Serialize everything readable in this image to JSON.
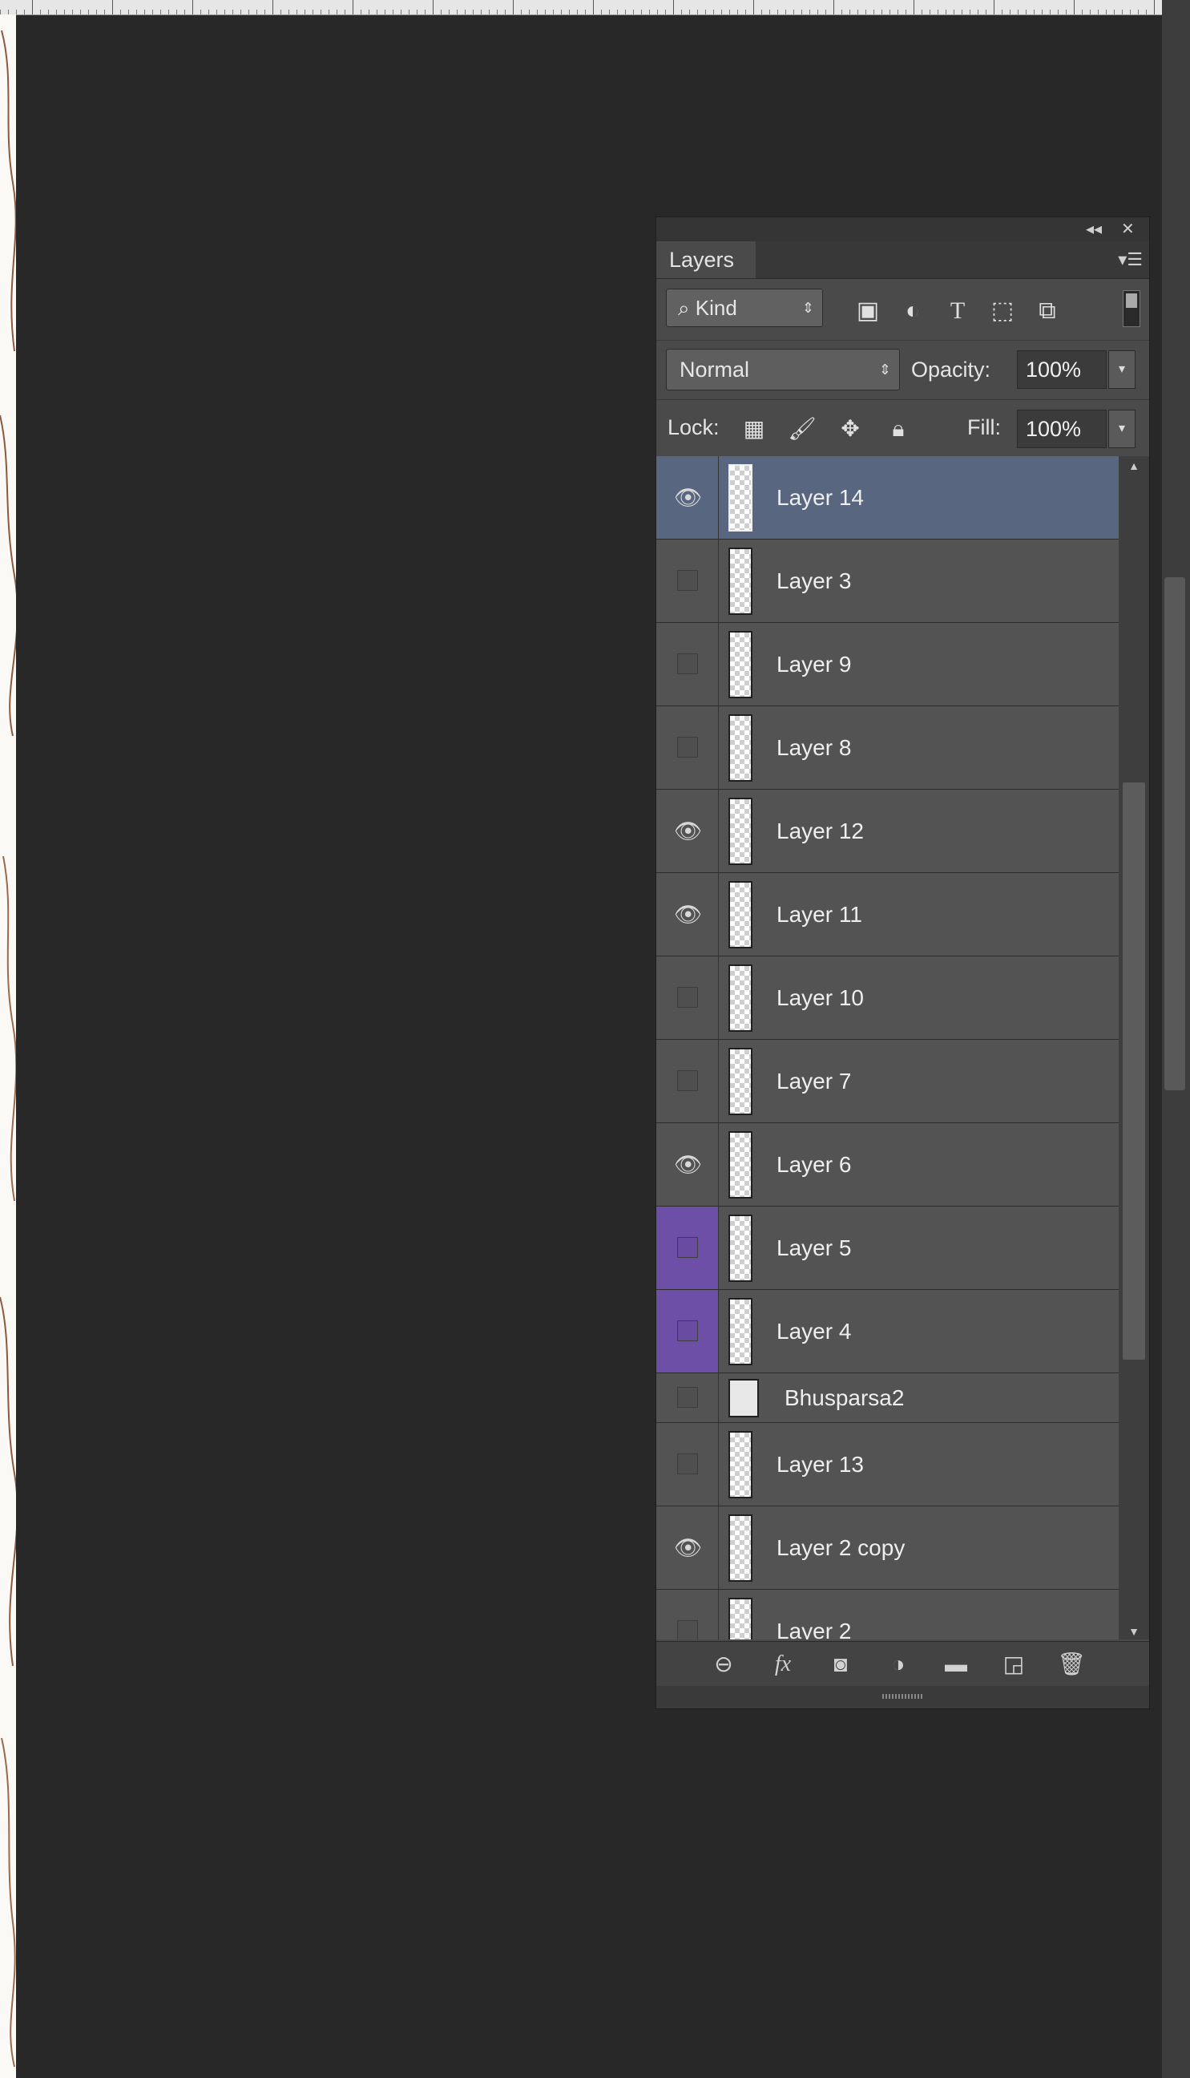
{
  "ruler": {},
  "panel": {
    "tab_label": "Layers",
    "collapse_label": "◂◂",
    "close_label": "✕",
    "menu_label": "▾☰",
    "filter": {
      "kind_label": "Kind",
      "search_glyph": "⌕",
      "icons": [
        "image-filter-icon",
        "adjustment-filter-icon",
        "type-filter-icon",
        "shape-filter-icon",
        "smart-object-filter-icon"
      ]
    },
    "blend": {
      "mode": "Normal",
      "opacity_label": "Opacity:",
      "opacity_value": "100%",
      "lock_label": "Lock:",
      "fill_label": "Fill:",
      "fill_value": "100%"
    },
    "layers": [
      {
        "name": "Layer 14",
        "visible": true,
        "selected": true,
        "tag": ""
      },
      {
        "name": "Layer 3",
        "visible": false,
        "selected": false,
        "tag": ""
      },
      {
        "name": "Layer 9",
        "visible": false,
        "selected": false,
        "tag": ""
      },
      {
        "name": "Layer 8",
        "visible": false,
        "selected": false,
        "tag": ""
      },
      {
        "name": "Layer 12",
        "visible": true,
        "selected": false,
        "tag": ""
      },
      {
        "name": "Layer 11",
        "visible": true,
        "selected": false,
        "tag": ""
      },
      {
        "name": "Layer 10",
        "visible": false,
        "selected": false,
        "tag": ""
      },
      {
        "name": "Layer 7",
        "visible": false,
        "selected": false,
        "tag": ""
      },
      {
        "name": "Layer 6",
        "visible": true,
        "selected": false,
        "tag": ""
      },
      {
        "name": "Layer 5",
        "visible": false,
        "selected": false,
        "tag": "violet"
      },
      {
        "name": "Layer 4",
        "visible": false,
        "selected": false,
        "tag": "violet"
      },
      {
        "name": "Bhusparsa2",
        "visible": false,
        "selected": false,
        "tag": "",
        "type": "group"
      },
      {
        "name": "Layer 13",
        "visible": false,
        "selected": false,
        "tag": ""
      },
      {
        "name": "Layer 2 copy",
        "visible": true,
        "selected": false,
        "tag": ""
      },
      {
        "name": "Layer 2",
        "visible": false,
        "selected": false,
        "tag": ""
      }
    ],
    "bottom_icons": [
      "link-layers-icon",
      "fx-icon",
      "layer-mask-icon",
      "adjustment-layer-icon",
      "new-group-icon",
      "new-layer-icon",
      "delete-layer-icon"
    ],
    "colors": {
      "selected_row": "#58677f",
      "violet_tag": "#6e4fa8",
      "panel_bg": "#4a4a4a"
    }
  }
}
